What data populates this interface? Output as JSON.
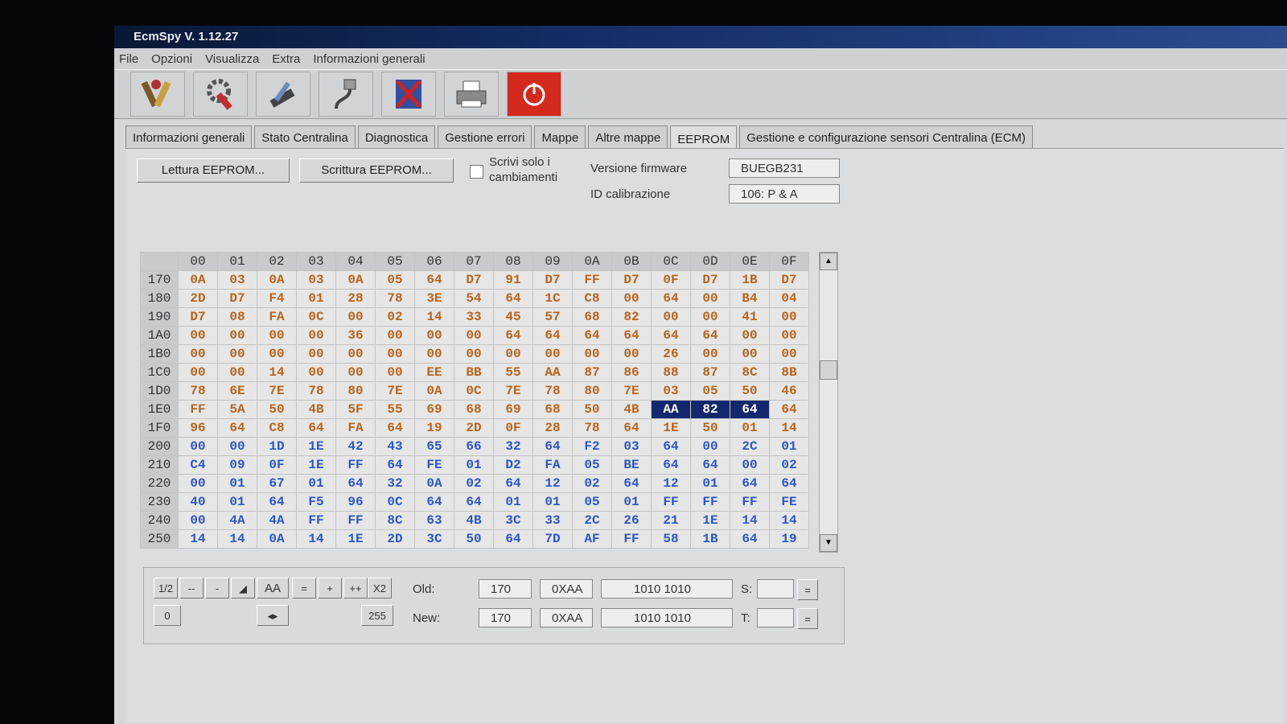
{
  "window": {
    "title": "EcmSpy V. 1.12.27"
  },
  "menu": [
    "File",
    "Opzioni",
    "Visualizza",
    "Extra",
    "Informazioni generali"
  ],
  "toolbar": {
    "icons": [
      "tools-icon",
      "gear-wrench-icon",
      "chip-tool-icon",
      "cable-icon",
      "exit-door-icon",
      "printer-icon",
      "power-icon"
    ]
  },
  "tabs": [
    "Informazioni generali",
    "Stato Centralina",
    "Diagnostica",
    "Gestione errori",
    "Mappe",
    "Altre mappe",
    "EEPROM",
    "Gestione e configurazione sensori Centralina (ECM)"
  ],
  "active_tab": "EEPROM",
  "eeprom": {
    "read_button": "Lettura EEPROM...",
    "write_button": "Scrittura EEPROM...",
    "write_changes_label_1": "Scrivi solo i",
    "write_changes_label_2": "cambiamenti",
    "firmware_label": "Versione firmware",
    "firmware_value": "BUEGB231",
    "calibration_label": "ID calibrazione",
    "calibration_value": "106: P & A"
  },
  "grid": {
    "columns": [
      "00",
      "01",
      "02",
      "03",
      "04",
      "05",
      "06",
      "07",
      "08",
      "09",
      "0A",
      "0B",
      "0C",
      "0D",
      "0E",
      "0F"
    ],
    "rows": [
      {
        "addr": "170",
        "color": "o",
        "cells": [
          "0A",
          "03",
          "0A",
          "03",
          "0A",
          "05",
          "64",
          "D7",
          "91",
          "D7",
          "FF",
          "D7",
          "0F",
          "D7",
          "1B",
          "D7"
        ]
      },
      {
        "addr": "180",
        "color": "o",
        "cells": [
          "2D",
          "D7",
          "F4",
          "01",
          "28",
          "78",
          "3E",
          "54",
          "64",
          "1C",
          "C8",
          "00",
          "64",
          "00",
          "B4",
          "04"
        ]
      },
      {
        "addr": "190",
        "color": "o",
        "cells": [
          "D7",
          "08",
          "FA",
          "0C",
          "00",
          "02",
          "14",
          "33",
          "45",
          "57",
          "68",
          "82",
          "00",
          "00",
          "41",
          "00"
        ]
      },
      {
        "addr": "1A0",
        "color": "o",
        "cells": [
          "00",
          "00",
          "00",
          "00",
          "36",
          "00",
          "00",
          "00",
          "64",
          "64",
          "64",
          "64",
          "64",
          "64",
          "00",
          "00"
        ]
      },
      {
        "addr": "1B0",
        "color": "o",
        "cells": [
          "00",
          "00",
          "00",
          "00",
          "00",
          "00",
          "00",
          "00",
          "00",
          "00",
          "00",
          "00",
          "26",
          "00",
          "00",
          "00"
        ]
      },
      {
        "addr": "1C0",
        "color": "o",
        "cells": [
          "00",
          "00",
          "14",
          "00",
          "00",
          "00",
          "EE",
          "BB",
          "55",
          "AA",
          "87",
          "86",
          "88",
          "87",
          "8C",
          "8B"
        ]
      },
      {
        "addr": "1D0",
        "color": "o",
        "cells": [
          "78",
          "6E",
          "7E",
          "78",
          "80",
          "7E",
          "0A",
          "0C",
          "7E",
          "78",
          "80",
          "7E",
          "03",
          "05",
          "50",
          "46"
        ]
      },
      {
        "addr": "1E0",
        "color": "o",
        "cells": [
          "FF",
          "5A",
          "50",
          "4B",
          "5F",
          "55",
          "69",
          "68",
          "69",
          "68",
          "50",
          "4B",
          "AA",
          "82",
          "64",
          "64"
        ]
      },
      {
        "addr": "1F0",
        "color": "o",
        "cells": [
          "96",
          "64",
          "C8",
          "64",
          "FA",
          "64",
          "19",
          "2D",
          "0F",
          "28",
          "78",
          "64",
          "1E",
          "50",
          "01",
          "14"
        ]
      },
      {
        "addr": "200",
        "color": "b",
        "cells": [
          "00",
          "00",
          "1D",
          "1E",
          "42",
          "43",
          "65",
          "66",
          "32",
          "64",
          "F2",
          "03",
          "64",
          "00",
          "2C",
          "01"
        ]
      },
      {
        "addr": "210",
        "color": "b",
        "cells": [
          "C4",
          "09",
          "0F",
          "1E",
          "FF",
          "64",
          "FE",
          "01",
          "D2",
          "FA",
          "05",
          "BE",
          "64",
          "64",
          "00",
          "02"
        ]
      },
      {
        "addr": "220",
        "color": "b",
        "cells": [
          "00",
          "01",
          "67",
          "01",
          "64",
          "32",
          "0A",
          "02",
          "64",
          "12",
          "02",
          "64",
          "12",
          "01",
          "64",
          "64"
        ]
      },
      {
        "addr": "230",
        "color": "b",
        "cells": [
          "40",
          "01",
          "64",
          "F5",
          "96",
          "0C",
          "64",
          "64",
          "01",
          "01",
          "05",
          "01",
          "FF",
          "FF",
          "FF",
          "FE"
        ]
      },
      {
        "addr": "240",
        "color": "b",
        "cells": [
          "00",
          "4A",
          "4A",
          "FF",
          "FF",
          "8C",
          "63",
          "4B",
          "3C",
          "33",
          "2C",
          "26",
          "21",
          "1E",
          "14",
          "14"
        ]
      },
      {
        "addr": "250",
        "color": "b",
        "cells": [
          "14",
          "14",
          "0A",
          "14",
          "1E",
          "2D",
          "3C",
          "50",
          "64",
          "7D",
          "AF",
          "FF",
          "58",
          "1B",
          "64",
          "19"
        ]
      }
    ],
    "selected": {
      "row": 7,
      "cols": [
        12,
        13,
        14
      ]
    }
  },
  "editor": {
    "btn_half": "1/2",
    "btn_minus2": "--",
    "btn_minus": "-",
    "value_display": "AA",
    "btn_eq": "=",
    "btn_plus": "+",
    "btn_plus2": "++",
    "btn_x2": "X2",
    "btn_zero": "0",
    "btn_255": "255",
    "old_label": "Old:",
    "old_dec": "170",
    "old_hex": "0XAA",
    "old_bin": "1010 1010",
    "new_label": "New:",
    "new_dec": "170",
    "new_hex": "0XAA",
    "new_bin": "1010 1010",
    "s_label": "S:",
    "t_label": "T:",
    "eq_button": "="
  }
}
